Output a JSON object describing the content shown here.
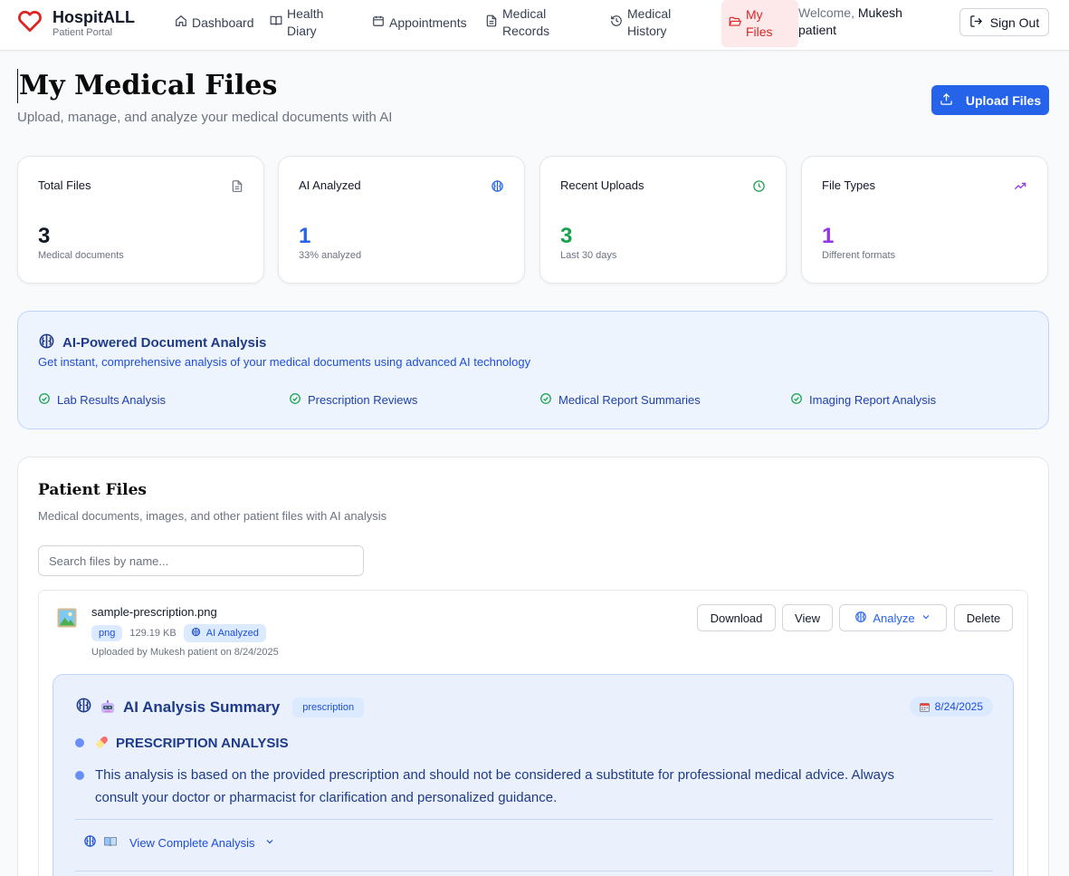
{
  "nav": {
    "brand_name": "HospitALL",
    "brand_sub": "Patient Portal",
    "items": [
      {
        "label": "Dashboard",
        "icon": "home-icon"
      },
      {
        "label": "Health Diary",
        "icon": "book-open-icon"
      },
      {
        "label": "Appointments",
        "icon": "calendar-icon"
      },
      {
        "label": "Medical Records",
        "icon": "file-text-icon"
      },
      {
        "label": "Medical History",
        "icon": "history-icon"
      },
      {
        "label": "My Files",
        "icon": "folder-open-icon",
        "active": true
      }
    ],
    "welcome_prefix": "Welcome,",
    "welcome_name": "Mukesh patient",
    "sign_out": "Sign Out"
  },
  "header": {
    "title": "My Medical Files",
    "subtitle": "Upload, manage, and analyze your medical documents with AI",
    "upload_button": "Upload Files"
  },
  "stats": [
    {
      "label": "Total Files",
      "value": "3",
      "sub": "Medical documents",
      "icon": "file-icon",
      "color": "#111827"
    },
    {
      "label": "AI Analyzed",
      "value": "1",
      "sub": "33% analyzed",
      "icon": "brain-icon",
      "color": "#2563eb"
    },
    {
      "label": "Recent Uploads",
      "value": "3",
      "sub": "Last 30 days",
      "icon": "clock-icon",
      "color": "#16a34a"
    },
    {
      "label": "File Types",
      "value": "1",
      "sub": "Different formats",
      "icon": "trending-up-icon",
      "color": "#9333ea"
    }
  ],
  "ai_banner": {
    "title": "AI-Powered Document Analysis",
    "description": "Get instant, comprehensive analysis of your medical documents using advanced AI technology",
    "features": [
      "Lab Results Analysis",
      "Prescription Reviews",
      "Medical Report Summaries",
      "Imaging Report Analysis"
    ]
  },
  "files": {
    "title": "Patient Files",
    "subtitle": "Medical documents, images, and other patient files with AI analysis",
    "search_placeholder": "Search files by name...",
    "items": [
      {
        "name": "sample-prescription.png",
        "ext": "png",
        "size": "129.19 KB",
        "ai_badge": "AI Analyzed",
        "uploaded": "Uploaded by Mukesh patient on 8/24/2025",
        "actions": {
          "download": "Download",
          "view": "View",
          "analyze": "Analyze",
          "delete": "Delete"
        },
        "summary": {
          "title": "AI Analysis Summary",
          "type_badge": "prescription",
          "date": "8/24/2025",
          "heading": "PRESCRIPTION ANALYSIS",
          "line_1": "This analysis is based on the provided prescription and should not be considered a substitute for professional medical advice. Always",
          "line_2": "consult your doctor or pharmacist for clarification and personalized guidance.",
          "view_complete": "View Complete Analysis"
        }
      }
    ]
  }
}
